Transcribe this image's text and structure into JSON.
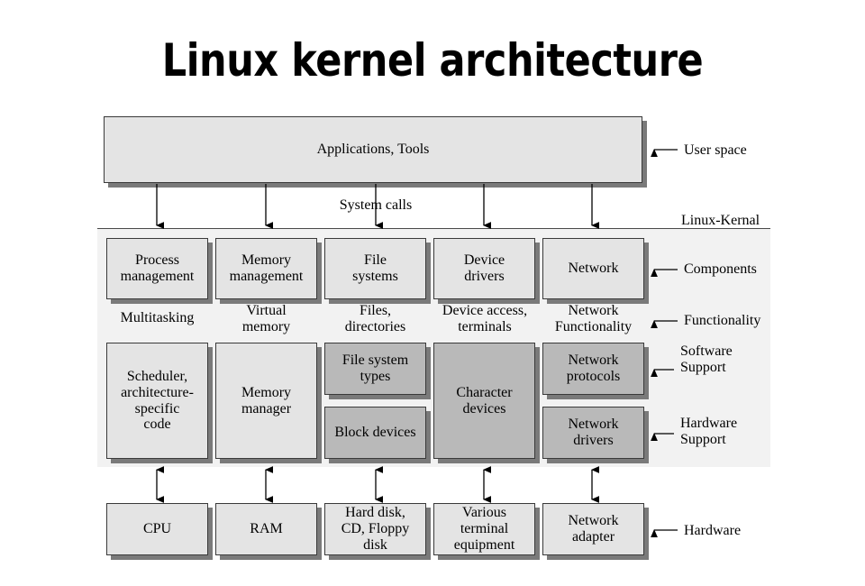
{
  "title": "Linux kernel architecture",
  "colors": {
    "box_light": "#e4e4e4",
    "box_dark": "#b9b9b9",
    "panel": "#f2f2f2",
    "shadow": "#7a7a7a",
    "stroke": "#3a3a3a",
    "background": "#ffffff"
  },
  "user_space": {
    "box_label": "Applications, Tools",
    "side_label": "User space"
  },
  "syscalls": {
    "label": "System calls"
  },
  "kernel": {
    "panel_label": "Linux-Kernal",
    "row_labels": {
      "components": "Components",
      "functionality": "Functionality",
      "software_support": "Software\nSupport",
      "hardware_support": "Hardware\nSupport"
    },
    "columns": [
      {
        "component": "Process\nmanagement",
        "functionality": "Multitasking",
        "software_support": "Scheduler,\narchitecture-\nspecific\ncode",
        "software_support_shade": "light",
        "hardware_support": null,
        "hardware": "CPU"
      },
      {
        "component": "Memory\nmanagement",
        "functionality": "Virtual\nmemory",
        "software_support": "Memory\nmanager",
        "software_support_shade": "light",
        "hardware_support": null,
        "hardware": "RAM"
      },
      {
        "component": "File\nsystems",
        "functionality": "Files,\ndirectories",
        "software_support": "File system\ntypes",
        "software_support_shade": "dark",
        "hardware_support": "Block devices",
        "hardware_support_shade": "dark",
        "hardware": "Hard disk,\nCD, Floppy\ndisk"
      },
      {
        "component": "Device\ndrivers",
        "functionality": "Device access,\nterminals",
        "software_support": "Character\ndevices",
        "software_support_shade": "dark",
        "hardware_support": null,
        "hardware": "Various\nterminal\nequipment"
      },
      {
        "component": "Network",
        "functionality": "Network\nFunctionality",
        "software_support": "Network\nprotocols",
        "software_support_shade": "dark",
        "hardware_support": "Network\ndrivers",
        "hardware_support_shade": "dark",
        "hardware": "Network\nadapter"
      }
    ]
  },
  "hardware_row": {
    "side_label": "Hardware"
  }
}
